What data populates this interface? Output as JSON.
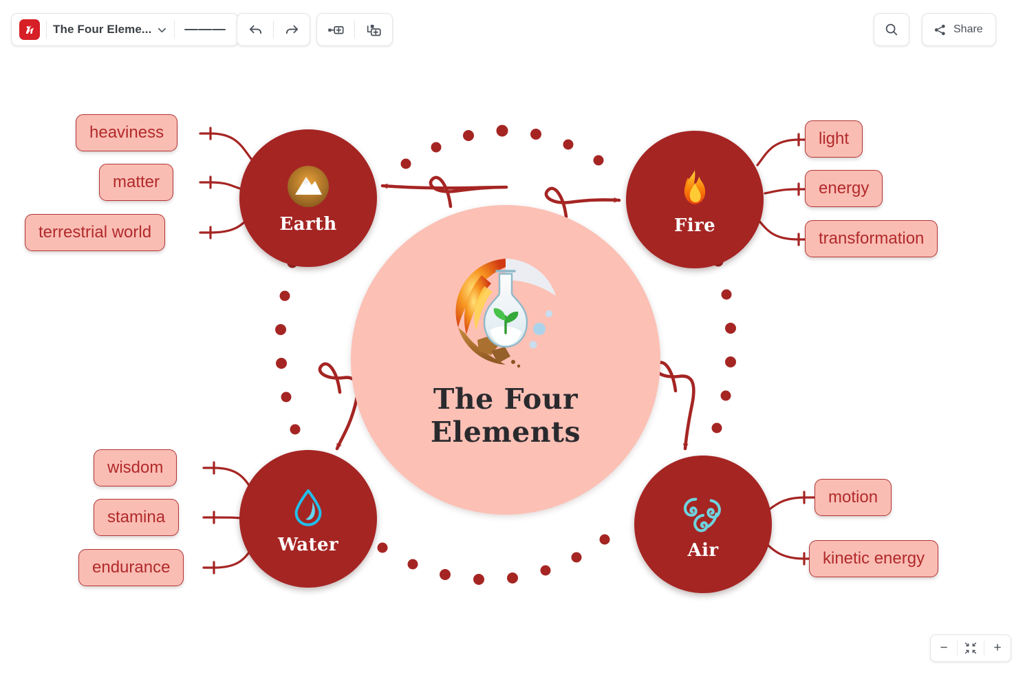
{
  "app": {
    "logo_name": "mindmap-logo",
    "document_title": "The Four Eleme...",
    "menu_icon": "hamburger-menu-icon",
    "caret_icon": "chevron-down-icon"
  },
  "toolbar": {
    "undo_label": "undo-icon",
    "redo_label": "redo-icon",
    "add_sibling_label": "add-sibling-topic-icon",
    "add_subtopic_label": "add-subtopic-icon",
    "search_label": "search-icon",
    "share_label": "Share",
    "share_icon": "share-icon"
  },
  "zoom_controls": {
    "zoom_out_label": "−",
    "fit_label": "fit-to-screen-icon",
    "zoom_in_label": "+"
  },
  "colors": {
    "node_red": "#A52523",
    "center_pink": "#FCC0B5",
    "leaf_fill": "#FABDB4",
    "leaf_border": "#B13434",
    "leaf_text": "#B12A2A",
    "connector": "#A52523",
    "brand_red": "#D61F26"
  },
  "mindmap": {
    "center": {
      "title_line_1": "The Four",
      "title_line_2": "Elements",
      "image_name": "four-elements-flask-illustration"
    },
    "branches": [
      {
        "id": "earth",
        "label": "Earth",
        "icon": "mountain-icon",
        "children": [
          {
            "label": "heaviness"
          },
          {
            "label": "matter"
          },
          {
            "label": "terrestrial world"
          }
        ]
      },
      {
        "id": "fire",
        "label": "Fire",
        "icon": "flame-icon",
        "children": [
          {
            "label": "light"
          },
          {
            "label": "energy"
          },
          {
            "label": "transformation"
          }
        ]
      },
      {
        "id": "water",
        "label": "Water",
        "icon": "water-drop-icon",
        "children": [
          {
            "label": "wisdom"
          },
          {
            "label": "stamina"
          },
          {
            "label": "endurance"
          }
        ]
      },
      {
        "id": "air",
        "label": "Air",
        "icon": "air-spiral-icon",
        "children": [
          {
            "label": "motion"
          },
          {
            "label": "kinetic energy"
          }
        ]
      }
    ]
  }
}
